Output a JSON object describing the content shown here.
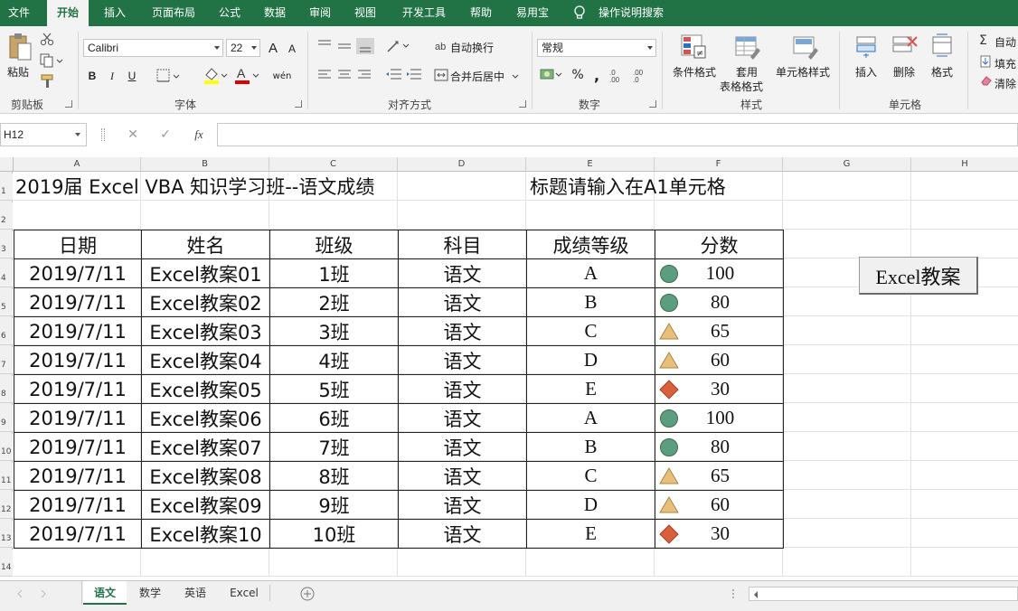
{
  "ribbon_tabs": [
    "文件",
    "开始",
    "插入",
    "页面布局",
    "公式",
    "数据",
    "审阅",
    "视图",
    "开发工具",
    "帮助",
    "易用宝",
    "操作说明搜索"
  ],
  "clipboard": {
    "paste_label": "粘贴",
    "group_label": "剪贴板"
  },
  "font": {
    "name": "Calibri",
    "size": "22",
    "bold": "B",
    "italic": "I",
    "underline": "U",
    "grow": "A",
    "shrink": "A",
    "phonetic": "wén",
    "group_label": "字体"
  },
  "alignment": {
    "wrap_text": "自动换行",
    "merge_center": "合并后居中",
    "group_label": "对齐方式"
  },
  "number": {
    "format": "常规",
    "percent": "%",
    "comma": ",",
    "group_label": "数字"
  },
  "styles": {
    "conditional": "条件格式",
    "table_format_1": "套用",
    "table_format_2": "表格格式",
    "cell_styles": "单元格样式",
    "group_label": "样式"
  },
  "cells": {
    "insert": "插入",
    "delete": "删除",
    "format": "格式",
    "group_label": "单元格"
  },
  "editing": {
    "autosum": "自动",
    "fill": "填充",
    "clear": "清除"
  },
  "formula_bar": {
    "name_box": "H12",
    "fx": "fx",
    "cancel": "✕",
    "enter": "✓",
    "formula": ""
  },
  "columns": [
    "A",
    "B",
    "C",
    "D",
    "E",
    "F",
    "G",
    "H"
  ],
  "rows": [
    "1",
    "2",
    "3",
    "4",
    "5",
    "6",
    "7",
    "8",
    "9",
    "10",
    "11",
    "12",
    "13",
    "14"
  ],
  "sheet": {
    "title": "2019届 Excel VBA 知识学习班--语文成绩",
    "note": "标题请输入在A1单元格",
    "headers": [
      "日期",
      "姓名",
      "班级",
      "科目",
      "成绩等级",
      "分数"
    ],
    "records": [
      {
        "date": "2019/7/11",
        "name": "Excel教案01",
        "class": "1班",
        "subject": "语文",
        "grade": "A",
        "icon": "green-circle",
        "score": "100"
      },
      {
        "date": "2019/7/11",
        "name": "Excel教案02",
        "class": "2班",
        "subject": "语文",
        "grade": "B",
        "icon": "green-circle",
        "score": "80"
      },
      {
        "date": "2019/7/11",
        "name": "Excel教案03",
        "class": "3班",
        "subject": "语文",
        "grade": "C",
        "icon": "yellow-triangle",
        "score": "65"
      },
      {
        "date": "2019/7/11",
        "name": "Excel教案04",
        "class": "4班",
        "subject": "语文",
        "grade": "D",
        "icon": "yellow-triangle",
        "score": "60"
      },
      {
        "date": "2019/7/11",
        "name": "Excel教案05",
        "class": "5班",
        "subject": "语文",
        "grade": "E",
        "icon": "red-diamond",
        "score": "30"
      },
      {
        "date": "2019/7/11",
        "name": "Excel教案06",
        "class": "6班",
        "subject": "语文",
        "grade": "A",
        "icon": "green-circle",
        "score": "100"
      },
      {
        "date": "2019/7/11",
        "name": "Excel教案07",
        "class": "7班",
        "subject": "语文",
        "grade": "B",
        "icon": "green-circle",
        "score": "80"
      },
      {
        "date": "2019/7/11",
        "name": "Excel教案08",
        "class": "8班",
        "subject": "语文",
        "grade": "C",
        "icon": "yellow-triangle",
        "score": "65"
      },
      {
        "date": "2019/7/11",
        "name": "Excel教案09",
        "class": "9班",
        "subject": "语文",
        "grade": "D",
        "icon": "yellow-triangle",
        "score": "60"
      },
      {
        "date": "2019/7/11",
        "name": "Excel教案10",
        "class": "10班",
        "subject": "语文",
        "grade": "E",
        "icon": "red-diamond",
        "score": "30"
      }
    ],
    "macro_button": "Excel教案"
  },
  "sheet_tabs": [
    "语文",
    "数学",
    "英语",
    "Excel"
  ],
  "colors": {
    "brand": "#217346",
    "green_icon": "#5a9e7f",
    "yellow_icon": "#e8c07a",
    "red_icon": "#d9603b"
  }
}
